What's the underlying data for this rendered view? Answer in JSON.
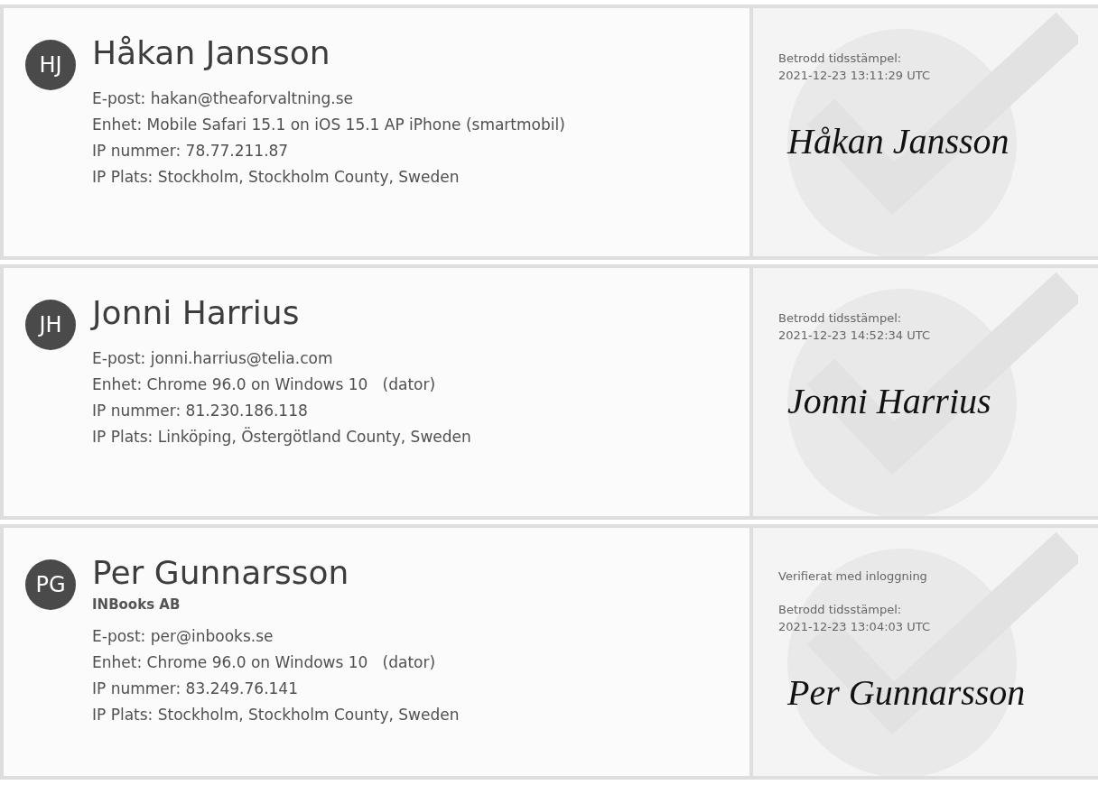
{
  "signers": [
    {
      "initials": "HJ",
      "name": "Håkan Jansson",
      "details": [
        "E-post: hakan@theaforvaltning.se",
        "Enhet: Mobile Safari 15.1 on iOS 15.1 AP iPhone (smartmobil)",
        "IP nummer: 78.77.211.87",
        "IP Plats: Stockholm, Stockholm County, Sweden"
      ],
      "timestamp_label": "Betrodd tidsstämpel:",
      "timestamp": "2021-12-23 13:11:29 UTC",
      "signature": "Håkan Jansson"
    },
    {
      "initials": "JH",
      "name": "Jonni Harrius",
      "details": [
        "E-post: jonni.harrius@telia.com",
        "Enhet: Chrome 96.0 on Windows 10   (dator)",
        "IP nummer: 81.230.186.118",
        "IP Plats: Linköping, Östergötland County, Sweden"
      ],
      "timestamp_label": "Betrodd tidsstämpel:",
      "timestamp": "2021-12-23 14:52:34 UTC",
      "signature": "Jonni Harrius"
    },
    {
      "initials": "PG",
      "name": "Per Gunnarsson",
      "company": "INBooks AB",
      "details": [
        "E-post: per@inbooks.se",
        "Enhet: Chrome 96.0 on Windows 10   (dator)",
        "IP nummer: 83.249.76.141",
        "IP Plats: Stockholm, Stockholm County, Sweden"
      ],
      "verification": "Verifierat med inloggning",
      "timestamp_label": "Betrodd tidsstämpel:",
      "timestamp": "2021-12-23 13:04:03 UTC",
      "signature": "Per Gunnarsson"
    }
  ]
}
